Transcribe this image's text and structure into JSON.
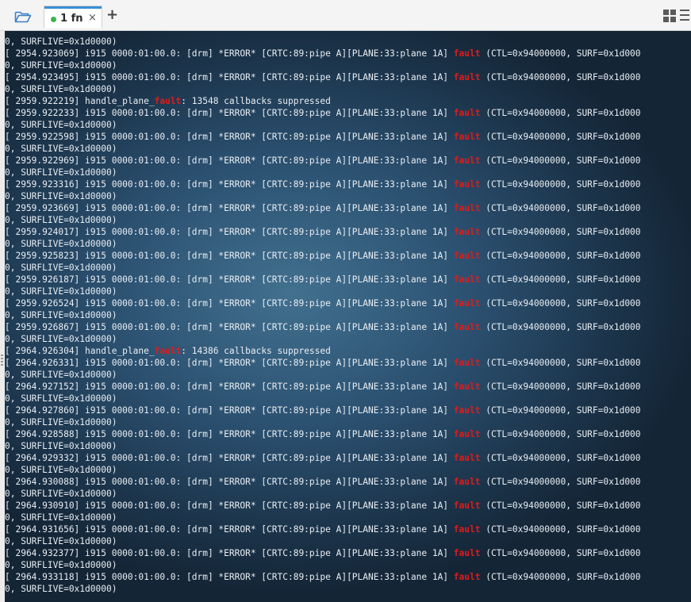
{
  "toolbar": {
    "tab_label": "1 fn",
    "close_glyph": "×",
    "add_glyph": "+",
    "icons": [
      "folder-icon",
      "grid-view-icon",
      "menu-icon"
    ]
  },
  "colors": {
    "accent": "#3a8fd6",
    "tab_dot": "#3bb34a",
    "fault": "#e01b1b",
    "text": "#e9eef3"
  },
  "terminal": {
    "lines": [
      {
        "pre": "0, SURFLIVE=0x1d0000)",
        "hl": "",
        "post": ""
      },
      {
        "pre": "[ 2954.923069] i915 0000:01:00.0: [drm] *ERROR* [CRTC:89:pipe A][PLANE:33:plane 1A] ",
        "hl": "fault",
        "post": " (CTL=0x94000000, SURF=0x1d000"
      },
      {
        "pre": "0, SURFLIVE=0x1d0000)",
        "hl": "",
        "post": ""
      },
      {
        "pre": "[ 2954.923495] i915 0000:01:00.0: [drm] *ERROR* [CRTC:89:pipe A][PLANE:33:plane 1A] ",
        "hl": "fault",
        "post": " (CTL=0x94000000, SURF=0x1d000"
      },
      {
        "pre": "0, SURFLIVE=0x1d0000)",
        "hl": "",
        "post": ""
      },
      {
        "pre": "[ 2959.922219] handle_plane_",
        "hl": "fault",
        "post": ": 13548 callbacks suppressed"
      },
      {
        "pre": "[ 2959.922233] i915 0000:01:00.0: [drm] *ERROR* [CRTC:89:pipe A][PLANE:33:plane 1A] ",
        "hl": "fault",
        "post": " (CTL=0x94000000, SURF=0x1d000"
      },
      {
        "pre": "0, SURFLIVE=0x1d0000)",
        "hl": "",
        "post": ""
      },
      {
        "pre": "[ 2959.922598] i915 0000:01:00.0: [drm] *ERROR* [CRTC:89:pipe A][PLANE:33:plane 1A] ",
        "hl": "fault",
        "post": " (CTL=0x94000000, SURF=0x1d000"
      },
      {
        "pre": "0, SURFLIVE=0x1d0000)",
        "hl": "",
        "post": ""
      },
      {
        "pre": "[ 2959.922969] i915 0000:01:00.0: [drm] *ERROR* [CRTC:89:pipe A][PLANE:33:plane 1A] ",
        "hl": "fault",
        "post": " (CTL=0x94000000, SURF=0x1d000"
      },
      {
        "pre": "0, SURFLIVE=0x1d0000)",
        "hl": "",
        "post": ""
      },
      {
        "pre": "[ 2959.923316] i915 0000:01:00.0: [drm] *ERROR* [CRTC:89:pipe A][PLANE:33:plane 1A] ",
        "hl": "fault",
        "post": " (CTL=0x94000000, SURF=0x1d000"
      },
      {
        "pre": "0, SURFLIVE=0x1d0000)",
        "hl": "",
        "post": ""
      },
      {
        "pre": "[ 2959.923669] i915 0000:01:00.0: [drm] *ERROR* [CRTC:89:pipe A][PLANE:33:plane 1A] ",
        "hl": "fault",
        "post": " (CTL=0x94000000, SURF=0x1d000"
      },
      {
        "pre": "0, SURFLIVE=0x1d0000)",
        "hl": "",
        "post": ""
      },
      {
        "pre": "[ 2959.924017] i915 0000:01:00.0: [drm] *ERROR* [CRTC:89:pipe A][PLANE:33:plane 1A] ",
        "hl": "fault",
        "post": " (CTL=0x94000000, SURF=0x1d000"
      },
      {
        "pre": "0, SURFLIVE=0x1d0000)",
        "hl": "",
        "post": ""
      },
      {
        "pre": "[ 2959.925823] i915 0000:01:00.0: [drm] *ERROR* [CRTC:89:pipe A][PLANE:33:plane 1A] ",
        "hl": "fault",
        "post": " (CTL=0x94000000, SURF=0x1d000"
      },
      {
        "pre": "0, SURFLIVE=0x1d0000)",
        "hl": "",
        "post": ""
      },
      {
        "pre": "[ 2959.926187] i915 0000:01:00.0: [drm] *ERROR* [CRTC:89:pipe A][PLANE:33:plane 1A] ",
        "hl": "fault",
        "post": " (CTL=0x94000000, SURF=0x1d000"
      },
      {
        "pre": "0, SURFLIVE=0x1d0000)",
        "hl": "",
        "post": ""
      },
      {
        "pre": "[ 2959.926524] i915 0000:01:00.0: [drm] *ERROR* [CRTC:89:pipe A][PLANE:33:plane 1A] ",
        "hl": "fault",
        "post": " (CTL=0x94000000, SURF=0x1d000"
      },
      {
        "pre": "0, SURFLIVE=0x1d0000)",
        "hl": "",
        "post": ""
      },
      {
        "pre": "[ 2959.926867] i915 0000:01:00.0: [drm] *ERROR* [CRTC:89:pipe A][PLANE:33:plane 1A] ",
        "hl": "fault",
        "post": " (CTL=0x94000000, SURF=0x1d000"
      },
      {
        "pre": "0, SURFLIVE=0x1d0000)",
        "hl": "",
        "post": ""
      },
      {
        "pre": "[ 2964.926304] handle_plane_",
        "hl": "fault",
        "post": ": 14386 callbacks suppressed"
      },
      {
        "pre": "[ 2964.926331] i915 0000:01:00.0: [drm] *ERROR* [CRTC:89:pipe A][PLANE:33:plane 1A] ",
        "hl": "fault",
        "post": " (CTL=0x94000000, SURF=0x1d000"
      },
      {
        "pre": "0, SURFLIVE=0x1d0000)",
        "hl": "",
        "post": ""
      },
      {
        "pre": "[ 2964.927152] i915 0000:01:00.0: [drm] *ERROR* [CRTC:89:pipe A][PLANE:33:plane 1A] ",
        "hl": "fault",
        "post": " (CTL=0x94000000, SURF=0x1d000"
      },
      {
        "pre": "0, SURFLIVE=0x1d0000)",
        "hl": "",
        "post": ""
      },
      {
        "pre": "[ 2964.927860] i915 0000:01:00.0: [drm] *ERROR* [CRTC:89:pipe A][PLANE:33:plane 1A] ",
        "hl": "fault",
        "post": " (CTL=0x94000000, SURF=0x1d000"
      },
      {
        "pre": "0, SURFLIVE=0x1d0000)",
        "hl": "",
        "post": ""
      },
      {
        "pre": "[ 2964.928588] i915 0000:01:00.0: [drm] *ERROR* [CRTC:89:pipe A][PLANE:33:plane 1A] ",
        "hl": "fault",
        "post": " (CTL=0x94000000, SURF=0x1d000"
      },
      {
        "pre": "0, SURFLIVE=0x1d0000)",
        "hl": "",
        "post": ""
      },
      {
        "pre": "[ 2964.929332] i915 0000:01:00.0: [drm] *ERROR* [CRTC:89:pipe A][PLANE:33:plane 1A] ",
        "hl": "fault",
        "post": " (CTL=0x94000000, SURF=0x1d000"
      },
      {
        "pre": "0, SURFLIVE=0x1d0000)",
        "hl": "",
        "post": ""
      },
      {
        "pre": "[ 2964.930088] i915 0000:01:00.0: [drm] *ERROR* [CRTC:89:pipe A][PLANE:33:plane 1A] ",
        "hl": "fault",
        "post": " (CTL=0x94000000, SURF=0x1d000"
      },
      {
        "pre": "0, SURFLIVE=0x1d0000)",
        "hl": "",
        "post": ""
      },
      {
        "pre": "[ 2964.930910] i915 0000:01:00.0: [drm] *ERROR* [CRTC:89:pipe A][PLANE:33:plane 1A] ",
        "hl": "fault",
        "post": " (CTL=0x94000000, SURF=0x1d000"
      },
      {
        "pre": "0, SURFLIVE=0x1d0000)",
        "hl": "",
        "post": ""
      },
      {
        "pre": "[ 2964.931656] i915 0000:01:00.0: [drm] *ERROR* [CRTC:89:pipe A][PLANE:33:plane 1A] ",
        "hl": "fault",
        "post": " (CTL=0x94000000, SURF=0x1d000"
      },
      {
        "pre": "0, SURFLIVE=0x1d0000)",
        "hl": "",
        "post": ""
      },
      {
        "pre": "[ 2964.932377] i915 0000:01:00.0: [drm] *ERROR* [CRTC:89:pipe A][PLANE:33:plane 1A] ",
        "hl": "fault",
        "post": " (CTL=0x94000000, SURF=0x1d000"
      },
      {
        "pre": "0, SURFLIVE=0x1d0000)",
        "hl": "",
        "post": ""
      },
      {
        "pre": "[ 2964.933118] i915 0000:01:00.0: [drm] *ERROR* [CRTC:89:pipe A][PLANE:33:plane 1A] ",
        "hl": "fault",
        "post": " (CTL=0x94000000, SURF=0x1d000"
      },
      {
        "pre": "0, SURFLIVE=0x1d0000)",
        "hl": "",
        "post": ""
      }
    ]
  }
}
